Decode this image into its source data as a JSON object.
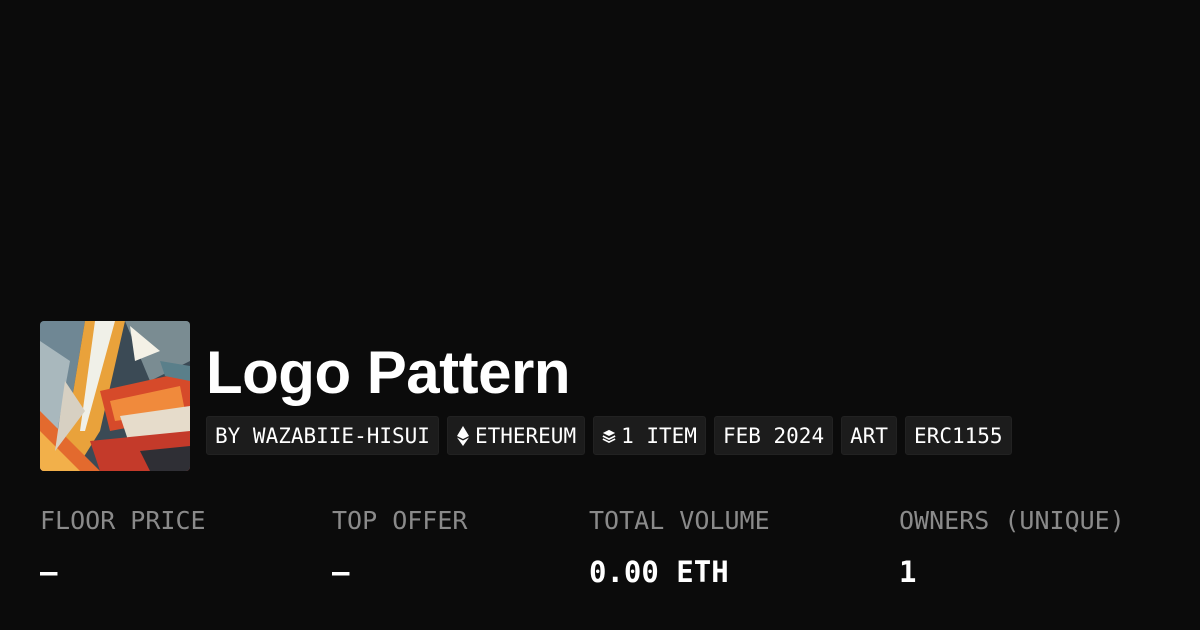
{
  "collection": {
    "title": "Logo Pattern",
    "thumbnail_icon": "abstract-art-thumbnail"
  },
  "tags": [
    {
      "label": "BY WAZABIIE-HISUI",
      "icon": null
    },
    {
      "label": "ETHEREUM",
      "icon": "ethereum-icon"
    },
    {
      "label": "1 ITEM",
      "icon": "layers-icon"
    },
    {
      "label": "FEB 2024",
      "icon": null
    },
    {
      "label": "ART",
      "icon": null
    },
    {
      "label": "ERC1155",
      "icon": null
    }
  ],
  "stats": [
    {
      "label": "FLOOR PRICE",
      "value": "–"
    },
    {
      "label": "TOP OFFER",
      "value": "–"
    },
    {
      "label": "TOTAL VOLUME",
      "value": "0.00 ETH"
    },
    {
      "label": "OWNERS (UNIQUE)",
      "value": "1"
    }
  ],
  "colors": {
    "background": "#0b0b0b",
    "tag_background": "#1c1c1c",
    "label_gray": "#8a8a8a",
    "text": "#ffffff"
  }
}
